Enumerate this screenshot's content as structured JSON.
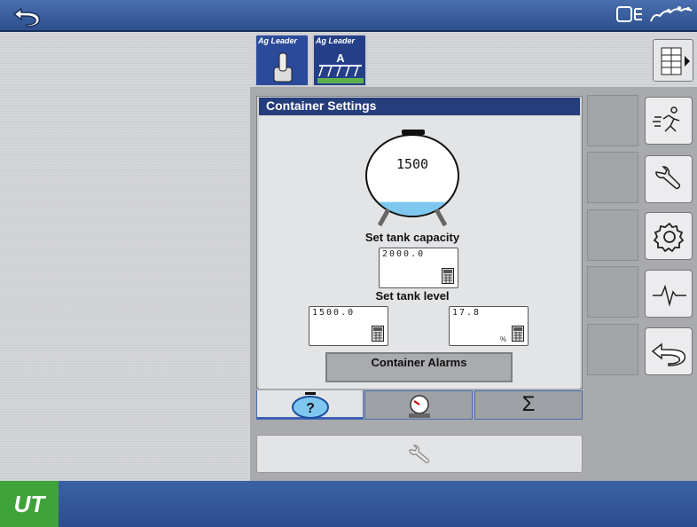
{
  "top_bar": {
    "back_icon": "back-arrow-icon",
    "status_icons": [
      "implement-status-icon",
      "gps-satellite-icon"
    ]
  },
  "tabs": [
    {
      "brand": "Ag Leader",
      "icon": "toggle-switch-icon"
    },
    {
      "brand": "Ag Leader",
      "icon": "sprayer-icon",
      "letter": "A"
    }
  ],
  "panel": {
    "title": "Container Settings",
    "tank_value": "1500",
    "capacity_label": "Set tank capacity",
    "capacity_value": "2000.0",
    "level_label": "Set tank level",
    "level_volume_value": "1500.0",
    "level_percent_value": "17.8",
    "level_percent_unit": "%",
    "alarms_button": "Container Alarms",
    "tank_fill_fraction": 0.178
  },
  "bottom_tabs": [
    {
      "icon": "tank-help-icon",
      "glyph": "?"
    },
    {
      "icon": "gauge-icon"
    },
    {
      "icon": "sum-icon",
      "glyph": "Σ"
    }
  ],
  "side_buttons": [
    "run-icon",
    "wrench-icon",
    "gear-icon",
    "diagnostics-icon",
    "back-arrow-icon"
  ],
  "footer": {
    "logo": "UT"
  },
  "colors": {
    "accent": "#253d7a",
    "logo_green": "#3fa33a",
    "tank_fluid": "#7ec8f0"
  }
}
